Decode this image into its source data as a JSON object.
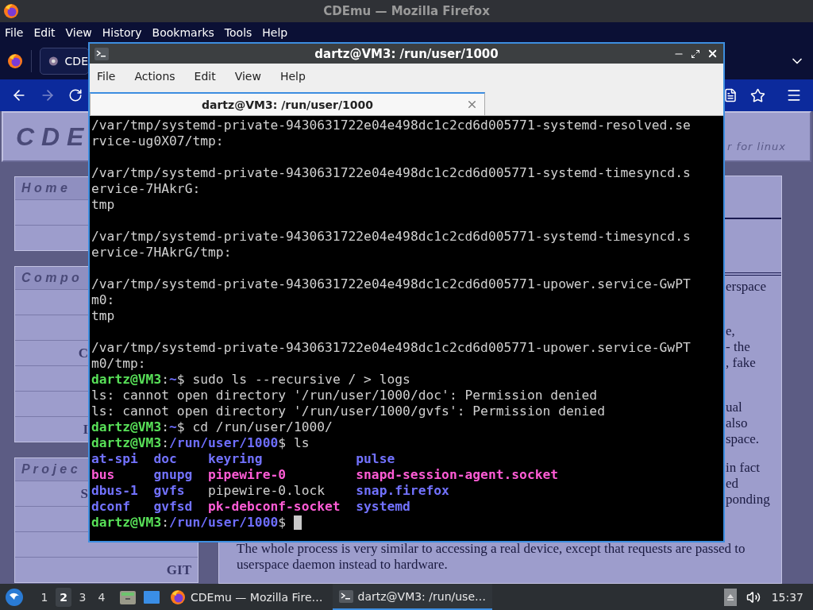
{
  "firefox": {
    "title": "CDEmu — Mozilla Firefox",
    "menu": [
      "File",
      "Edit",
      "View",
      "History",
      "Bookmarks",
      "Tools",
      "Help"
    ],
    "tab": {
      "title": "CDE"
    },
    "page": {
      "logo": "C D E",
      "tagline": "r for linux",
      "sidebar": [
        {
          "heading": "H o m e",
          "rows": [
            {
              "kind": "empty"
            },
            {
              "kind": "empty"
            }
          ]
        },
        {
          "heading": "C o m p o",
          "rows": [
            {
              "kind": "empty"
            },
            {
              "kind": "empty"
            },
            {
              "kind": "cut",
              "text": "C"
            },
            {
              "kind": "empty"
            },
            {
              "kind": "empty"
            },
            {
              "kind": "cut",
              "text": "I"
            }
          ]
        },
        {
          "heading": "P r o j e c",
          "rows": [
            {
              "kind": "cut",
              "text": "S"
            },
            {
              "kind": "empty"
            },
            {
              "kind": "empty"
            },
            {
              "kind": "label",
              "text": "GIT"
            }
          ]
        }
      ],
      "content": [
        {
          "kind": "rule"
        },
        {
          "kind": "double_rule"
        },
        {
          "kind": "fragments",
          "lines": [
            "erspace"
          ]
        },
        {
          "kind": "fragments",
          "lines": [
            "e,",
            "- the",
            ", fake"
          ]
        },
        {
          "kind": "fragments",
          "lines": [
            "ual",
            "also",
            "space."
          ]
        },
        {
          "kind": "fragments",
          "lines": [
            "in fact",
            "ed",
            "ponding"
          ]
        },
        {
          "kind": "paragraph",
          "text": "The whole process is very similar to accessing a real device, except that requests are passed to userspace daemon instead to hardware."
        }
      ]
    }
  },
  "terminal": {
    "title": "dartz@VM3: /run/user/1000",
    "menu": [
      "File",
      "Actions",
      "Edit",
      "View",
      "Help"
    ],
    "tab": {
      "title": "dartz@VM3: /run/user/1000"
    },
    "lines": [
      {
        "kind": "text",
        "segments": [
          {
            "kind": "plain",
            "text": "/var/tmp/systemd-private-9430631722e04e498dc1c2cd6d005771-systemd-resolved.se"
          }
        ]
      },
      {
        "kind": "text",
        "segments": [
          {
            "kind": "plain",
            "text": "rvice-ug0X07/tmp:"
          }
        ]
      },
      {
        "kind": "blank"
      },
      {
        "kind": "text",
        "segments": [
          {
            "kind": "plain",
            "text": "/var/tmp/systemd-private-9430631722e04e498dc1c2cd6d005771-systemd-timesyncd.s"
          }
        ]
      },
      {
        "kind": "text",
        "segments": [
          {
            "kind": "plain",
            "text": "ervice-7HAkrG:"
          }
        ]
      },
      {
        "kind": "text",
        "segments": [
          {
            "kind": "plain",
            "text": "tmp"
          }
        ]
      },
      {
        "kind": "blank"
      },
      {
        "kind": "text",
        "segments": [
          {
            "kind": "plain",
            "text": "/var/tmp/systemd-private-9430631722e04e498dc1c2cd6d005771-systemd-timesyncd.s"
          }
        ]
      },
      {
        "kind": "text",
        "segments": [
          {
            "kind": "plain",
            "text": "ervice-7HAkrG/tmp:"
          }
        ]
      },
      {
        "kind": "blank"
      },
      {
        "kind": "text",
        "segments": [
          {
            "kind": "plain",
            "text": "/var/tmp/systemd-private-9430631722e04e498dc1c2cd6d005771-upower.service-GwPT"
          }
        ]
      },
      {
        "kind": "text",
        "segments": [
          {
            "kind": "plain",
            "text": "m0:"
          }
        ]
      },
      {
        "kind": "text",
        "segments": [
          {
            "kind": "plain",
            "text": "tmp"
          }
        ]
      },
      {
        "kind": "blank"
      },
      {
        "kind": "text",
        "segments": [
          {
            "kind": "plain",
            "text": "/var/tmp/systemd-private-9430631722e04e498dc1c2cd6d005771-upower.service-GwPT"
          }
        ]
      },
      {
        "kind": "text",
        "segments": [
          {
            "kind": "plain",
            "text": "m0/tmp:"
          }
        ]
      },
      {
        "kind": "text",
        "segments": [
          {
            "kind": "user",
            "text": "dartz@VM3"
          },
          {
            "kind": "plain",
            "text": ":"
          },
          {
            "kind": "path",
            "text": "~"
          },
          {
            "kind": "plain",
            "text": "$ sudo ls --recursive / > logs"
          }
        ]
      },
      {
        "kind": "text",
        "segments": [
          {
            "kind": "plain",
            "text": "ls: cannot open directory '/run/user/1000/doc': Permission denied"
          }
        ]
      },
      {
        "kind": "text",
        "segments": [
          {
            "kind": "plain",
            "text": "ls: cannot open directory '/run/user/1000/gvfs': Permission denied"
          }
        ]
      },
      {
        "kind": "text",
        "segments": [
          {
            "kind": "user",
            "text": "dartz@VM3"
          },
          {
            "kind": "plain",
            "text": ":"
          },
          {
            "kind": "path",
            "text": "~"
          },
          {
            "kind": "plain",
            "text": "$ cd /run/user/1000/"
          }
        ]
      },
      {
        "kind": "text",
        "segments": [
          {
            "kind": "user",
            "text": "dartz@VM3"
          },
          {
            "kind": "plain",
            "text": ":"
          },
          {
            "kind": "path",
            "text": "/run/user/1000"
          },
          {
            "kind": "plain",
            "text": "$ ls"
          }
        ]
      },
      {
        "kind": "columns",
        "cells": [
          {
            "kind": "dir",
            "text": "at-spi"
          },
          {
            "kind": "dir",
            "text": "doc"
          },
          {
            "kind": "dir",
            "text": "keyring"
          },
          {
            "kind": "dir",
            "text": "pulse"
          }
        ]
      },
      {
        "kind": "columns",
        "cells": [
          {
            "kind": "special",
            "text": "bus"
          },
          {
            "kind": "dir",
            "text": "gnupg"
          },
          {
            "kind": "special",
            "text": "pipewire-0"
          },
          {
            "kind": "special",
            "text": "snapd-session-agent.socket"
          }
        ]
      },
      {
        "kind": "columns",
        "cells": [
          {
            "kind": "dir",
            "text": "dbus-1"
          },
          {
            "kind": "dir",
            "text": "gvfs"
          },
          {
            "kind": "plain",
            "text": "pipewire-0.lock"
          },
          {
            "kind": "dir",
            "text": "snap.firefox"
          }
        ]
      },
      {
        "kind": "columns",
        "cells": [
          {
            "kind": "dir",
            "text": "dconf"
          },
          {
            "kind": "dir",
            "text": "gvfsd"
          },
          {
            "kind": "special",
            "text": "pk-debconf-socket"
          },
          {
            "kind": "dir",
            "text": "systemd"
          }
        ]
      },
      {
        "kind": "text",
        "segments": [
          {
            "kind": "user",
            "text": "dartz@VM3"
          },
          {
            "kind": "plain",
            "text": ":"
          },
          {
            "kind": "path",
            "text": "/run/user/1000"
          },
          {
            "kind": "plain",
            "text": "$"
          }
        ]
      }
    ],
    "cursor": true
  },
  "taskbar": {
    "workspaces": [
      {
        "label": "1",
        "selected": false
      },
      {
        "label": "2",
        "selected": true
      },
      {
        "label": "3",
        "selected": false
      },
      {
        "label": "4",
        "selected": false
      }
    ],
    "tasks": [
      {
        "kind": "firefox",
        "title": "CDEmu — Mozilla Fire…",
        "selected": false
      },
      {
        "kind": "terminal",
        "title": "dartz@VM3: /run/use…",
        "selected": true
      }
    ],
    "clock": "15:37"
  }
}
